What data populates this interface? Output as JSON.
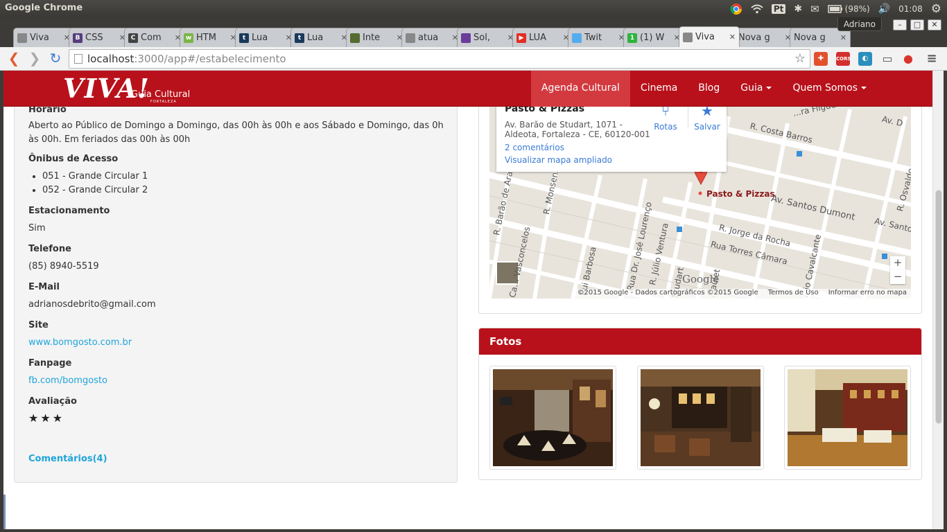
{
  "os": {
    "app_title": "Google Chrome",
    "tray_pt": "Pt",
    "battery": "(98%)",
    "time": "01:08"
  },
  "browser": {
    "user": "Adriano",
    "tabs": [
      {
        "label": "Viva",
        "color": "#888888",
        "glyph": ""
      },
      {
        "label": "CSS",
        "color": "#563d7c",
        "glyph": "B"
      },
      {
        "label": "Com",
        "color": "#444444",
        "glyph": "C"
      },
      {
        "label": "HTM",
        "color": "#7ab648",
        "glyph": "w"
      },
      {
        "label": "Lua",
        "color": "#1a3a5c",
        "glyph": "t"
      },
      {
        "label": "Lua",
        "color": "#1a3a5c",
        "glyph": "t"
      },
      {
        "label": "Inte",
        "color": "#556b2f",
        "glyph": ""
      },
      {
        "label": "atua",
        "color": "#888888",
        "glyph": ""
      },
      {
        "label": "Sol,",
        "color": "#6a3d9a",
        "glyph": ""
      },
      {
        "label": "LUA",
        "color": "#e52d27",
        "glyph": "▶"
      },
      {
        "label": "Twit",
        "color": "#55acee",
        "glyph": ""
      },
      {
        "label": "(1) W",
        "color": "#2fb43c",
        "glyph": "1"
      },
      {
        "label": "Viva",
        "color": "#888888",
        "glyph": "",
        "active": true
      },
      {
        "label": "Nova g",
        "color": "",
        "glyph": ""
      },
      {
        "label": "Nova g",
        "color": "",
        "glyph": ""
      }
    ],
    "url_host": "localhost",
    "url_rest": ":3000/app#/estabelecimento"
  },
  "site": {
    "logo_main": "VIVA!",
    "logo_sub": "Guia Cultural",
    "logo_city": "FORTALEZA",
    "nav": [
      {
        "label": "Agenda Cultural",
        "active": true,
        "caret": false
      },
      {
        "label": "Cinema",
        "caret": false
      },
      {
        "label": "Blog",
        "caret": false
      },
      {
        "label": "Guia",
        "caret": true
      },
      {
        "label": "Quem Somos",
        "caret": true
      }
    ]
  },
  "info": {
    "horario_label": "Horário",
    "horario_text": "Aberto ao Público de Domingo a Domingo, das 00h às 00h e aos Sábado e Domingo, das 0h às 00h. Em feriados das 00h às 00h",
    "onibus_label": "Ônibus de Acesso",
    "onibus": [
      "051 - Grande Circular 1",
      "052 - Grande Circular 2"
    ],
    "estacionamento_label": "Estacionamento",
    "estacionamento": "Sim",
    "telefone_label": "Telefone",
    "telefone": "(85) 8940-5519",
    "email_label": "E-Mail",
    "email": "adrianosdebrito@gmail.com",
    "site_label": "Site",
    "site": "www.bomgosto.com.br",
    "fanpage_label": "Fanpage",
    "fanpage": "fb.com/bomgosto",
    "avaliacao_label": "Avaliação",
    "rating": 3,
    "rating_stars": "★★★",
    "comentarios": "Comentários(4)"
  },
  "map": {
    "place": "Pasto & Pizzas",
    "address": "Av. Barão de Studart, 1071 - Aldeota, Fortaleza - CE, 60120-001",
    "reviews_link": "2 comentários",
    "view_link": "Visualizar mapa ampliado",
    "rotas": "Rotas",
    "salvar": "Salvar",
    "marker_label": "Pasto & Pizzas",
    "streets": {
      "costa_barros": "R. Costa Barros",
      "santos_dumont": "Av. Santos Dumont",
      "jorge_rocha": "R. Jorge da Rocha",
      "torres_camara": "Rua Torres Câmara",
      "monsenhor_bruno": "R. Monsenhor Bruno",
      "rui_barbosa": "Rui Barbosa",
      "jose_lourenco": "Rua Dr. José Lourenço",
      "julio_ventura": "R. Júlio Ventura",
      "barao_aracati": "R. Barão de Aracati",
      "vasconcelos": "Ca... Vasconcelos",
      "filgueiras": "...ra Filgueiras",
      "av_d": "Av. D",
      "av_santo": "Av. Santo",
      "osvaldo": "R. Osvaldo",
      "studart": "Studart",
      "cavalcante": "...io Cavalcante",
      "paulet": "...aulet"
    },
    "google": "Google",
    "copyright": "©2015 Google - Dados cartográficos ©2015 Google",
    "terms": "Termos de Uso",
    "report": "Informar erro no mapa",
    "zoom_in": "+",
    "zoom_out": "−"
  },
  "photos": {
    "title": "Fotos",
    "count": 3
  }
}
